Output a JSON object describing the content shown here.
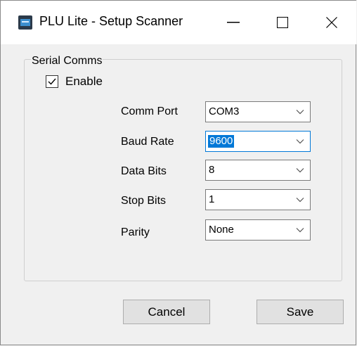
{
  "window": {
    "title": "PLU Lite - Setup Scanner"
  },
  "serial": {
    "group_label": "Serial Comms",
    "enable_label": "Enable",
    "enable_checked": true,
    "fields": {
      "comm_port": {
        "label": "Comm Port",
        "value": "COM3"
      },
      "baud_rate": {
        "label": "Baud Rate",
        "value": "9600"
      },
      "data_bits": {
        "label": "Data Bits",
        "value": "8"
      },
      "stop_bits": {
        "label": "Stop Bits",
        "value": "1"
      },
      "parity": {
        "label": "Parity",
        "value": "None"
      }
    }
  },
  "buttons": {
    "cancel": "Cancel",
    "save": "Save"
  },
  "icons": {
    "app": "scanner-app-icon",
    "minimize": "minimize-icon",
    "maximize": "maximize-icon",
    "close": "close-icon",
    "check": "check-icon",
    "dropdown": "chevron-down-icon"
  },
  "colors": {
    "focus": "#0078d7",
    "window_bg": "#f0f0f0",
    "titlebar_bg": "#ffffff"
  }
}
